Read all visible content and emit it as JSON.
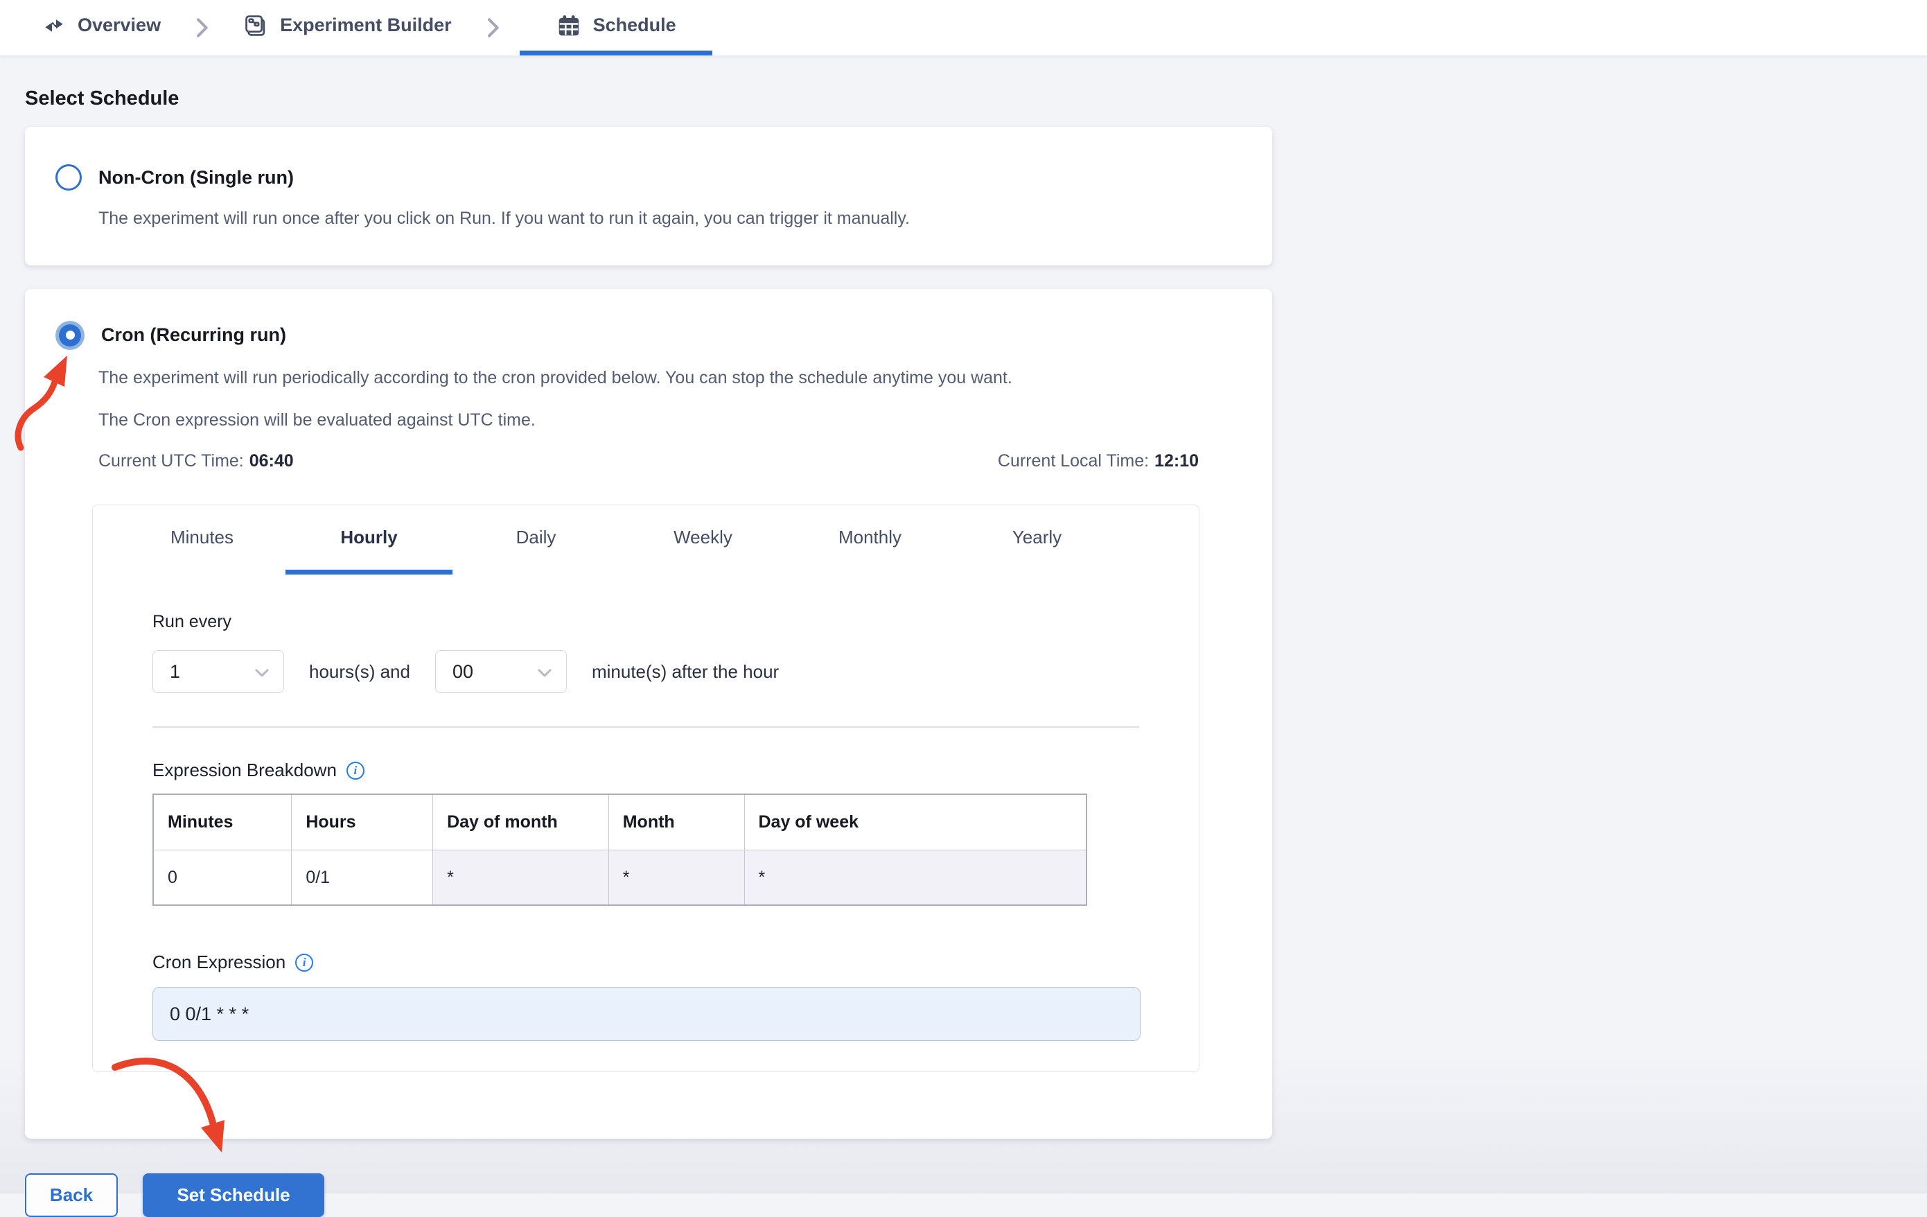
{
  "breadcrumb": {
    "items": [
      {
        "label": "Overview",
        "icon": "overview-icon"
      },
      {
        "label": "Experiment Builder",
        "icon": "experiment-builder-icon"
      },
      {
        "label": "Schedule",
        "icon": "calendar-icon",
        "active": true
      }
    ]
  },
  "page": {
    "title": "Select Schedule"
  },
  "options": {
    "non_cron": {
      "title": "Non-Cron (Single run)",
      "description": "The experiment will run once after you click on Run. If you want to run it again, you can trigger it manually.",
      "selected": false
    },
    "cron": {
      "title": "Cron (Recurring run)",
      "description_line1": "The experiment will run periodically according to the cron provided below. You can stop the schedule anytime you want.",
      "description_line2": "The Cron expression will be evaluated against UTC time.",
      "utc_label": "Current UTC Time:",
      "utc_value": "06:40",
      "local_label": "Current Local Time:",
      "local_value": "12:10",
      "selected": true
    }
  },
  "scheduler": {
    "tabs": [
      "Minutes",
      "Hourly",
      "Daily",
      "Weekly",
      "Monthly",
      "Yearly"
    ],
    "active_tab": "Hourly",
    "run_every_label": "Run every",
    "hours_value": "1",
    "hours_suffix": "hours(s) and",
    "minutes_value": "00",
    "minutes_suffix": "minute(s) after the hour",
    "expression_breakdown_label": "Expression Breakdown",
    "table": {
      "headers": [
        "Minutes",
        "Hours",
        "Day of month",
        "Month",
        "Day of week"
      ],
      "row": [
        "0",
        "0/1",
        "*",
        "*",
        "*"
      ]
    },
    "cron_expression_label": "Cron Expression",
    "cron_expression_value": "0 0/1 * * *"
  },
  "footer": {
    "back_label": "Back",
    "set_schedule_label": "Set Schedule"
  },
  "colors": {
    "accent": "#2e6fd2",
    "button_primary": "#3273d1",
    "annotation_arrow": "#e8432a",
    "cron_input_bg": "#e9f1fc",
    "table_shaded_cell": "#f1f1f7",
    "page_bg": "#f3f4f8"
  }
}
